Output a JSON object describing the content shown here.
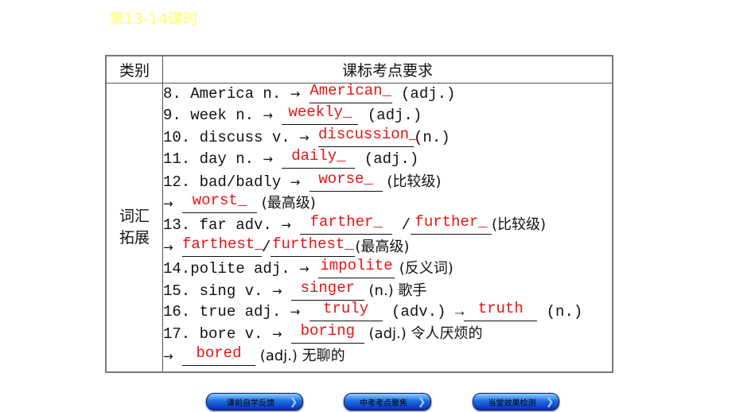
{
  "title": "第13-14课时",
  "table": {
    "headers": [
      "类别",
      "课标考点要求"
    ],
    "category": "词汇拓展",
    "category_lines": [
      "词汇",
      "拓展"
    ],
    "rows": [
      {
        "prefix": "8. America n. ",
        "arrow": "→",
        "answers": [
          "American_"
        ],
        "suffix": " (adj.)"
      },
      {
        "prefix": "9. week n. ",
        "arrow": "→",
        "answers": [
          "weekly_"
        ],
        "suffix": " (adj.)"
      },
      {
        "prefix": "10. discuss v. ",
        "arrow": "→",
        "answers": [
          "discussion_"
        ],
        "suffix": "(n.)"
      },
      {
        "prefix": "11. day n. ",
        "arrow": "→",
        "answers": [
          "daily_"
        ],
        "suffix": " (adj.)"
      },
      {
        "prefix": "12. bad/badly ",
        "arrow": "→",
        "answers": [
          "worse_"
        ],
        "suffix": " (比较级)"
      },
      {
        "prefix": " ",
        "arrow": "→",
        "answers": [
          "worst_"
        ],
        "suffix": " (最高级)"
      },
      {
        "prefix": "13. far adv. ",
        "arrow": "→",
        "answers": [
          "farther_",
          "further_"
        ],
        "separator": " /",
        "suffix": "(比较级)"
      },
      {
        "prefix": " ",
        "arrow": "→",
        "answers": [
          "farthest_",
          "furthest_"
        ],
        "separator": "/",
        "suffix": "(最高级)"
      },
      {
        "prefix": "14.polite adj. ",
        "arrow": "→",
        "answers": [
          "impolite"
        ],
        "suffix": " (反义词)"
      },
      {
        "prefix": "15. sing v. ",
        "arrow": "→",
        "answers": [
          "singer"
        ],
        "suffix": " (n.) 歌手"
      },
      {
        "prefix": "16. true adj. ",
        "arrow": "→",
        "answers": [
          "truly",
          "truth"
        ],
        "separator": " (adv.) →",
        "suffix": " (n.)"
      },
      {
        "prefix": "17. bore v. ",
        "arrow": "→",
        "answers": [
          "boring"
        ],
        "suffix": " (adj.) 令人厌烦的"
      },
      {
        "prefix": " ",
        "arrow": "→",
        "answers": [
          "bored"
        ],
        "suffix": " (adj.) 无聊的"
      }
    ]
  },
  "nav": {
    "buttons": [
      {
        "label": "课前自学反馈",
        "icon": "chevron-right-icon"
      },
      {
        "label": "中考考点聚焦",
        "icon": "chevron-right-icon"
      },
      {
        "label": "当堂效果检测",
        "icon": "chevron-right-icon"
      }
    ]
  },
  "colors": {
    "title": "#ffff66",
    "answer": "#ee1111",
    "nav_button": "#1f6fe0"
  }
}
